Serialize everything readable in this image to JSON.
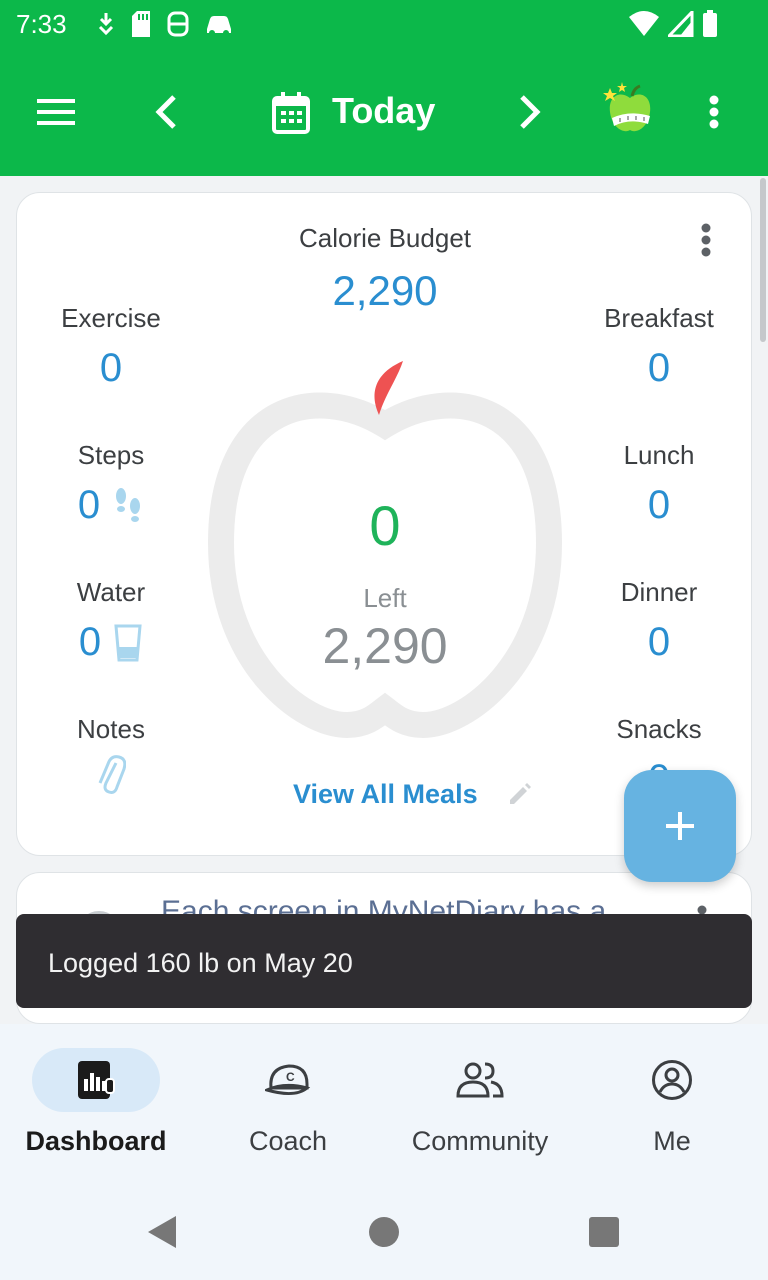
{
  "status": {
    "time": "7:33"
  },
  "app_bar": {
    "title": "Today"
  },
  "calorie_budget": {
    "label": "Calorie Budget",
    "value": "2,290"
  },
  "left_column": [
    {
      "label": "Exercise",
      "value": "0"
    },
    {
      "label": "Steps",
      "value": "0"
    },
    {
      "label": "Water",
      "value": "0"
    },
    {
      "label": "Notes"
    }
  ],
  "right_column": [
    {
      "label": "Breakfast",
      "value": "0"
    },
    {
      "label": "Lunch",
      "value": "0"
    },
    {
      "label": "Dinner",
      "value": "0"
    },
    {
      "label": "Snacks",
      "value": "0"
    }
  ],
  "center": {
    "consumed": "0",
    "left_label": "Left",
    "left_value": "2,290"
  },
  "view_all_meals": "View All Meals",
  "tip": {
    "text": "Each screen in MyNetDiary has a"
  },
  "snackbar": {
    "message": "Logged 160 lb on May 20"
  },
  "bottom_nav": [
    {
      "label": "Dashboard",
      "icon": "dashboard-icon",
      "active": true
    },
    {
      "label": "Coach",
      "icon": "coach-cap-icon",
      "active": false
    },
    {
      "label": "Community",
      "icon": "community-icon",
      "active": false
    },
    {
      "label": "Me",
      "icon": "profile-icon",
      "active": false
    }
  ],
  "colors": {
    "brand_green": "#0cb84a",
    "value_blue": "#2a8ed0",
    "consumed_green": "#1fb35a",
    "fab_blue": "#66b3e1",
    "apple_stem_red": "#ee5252"
  }
}
